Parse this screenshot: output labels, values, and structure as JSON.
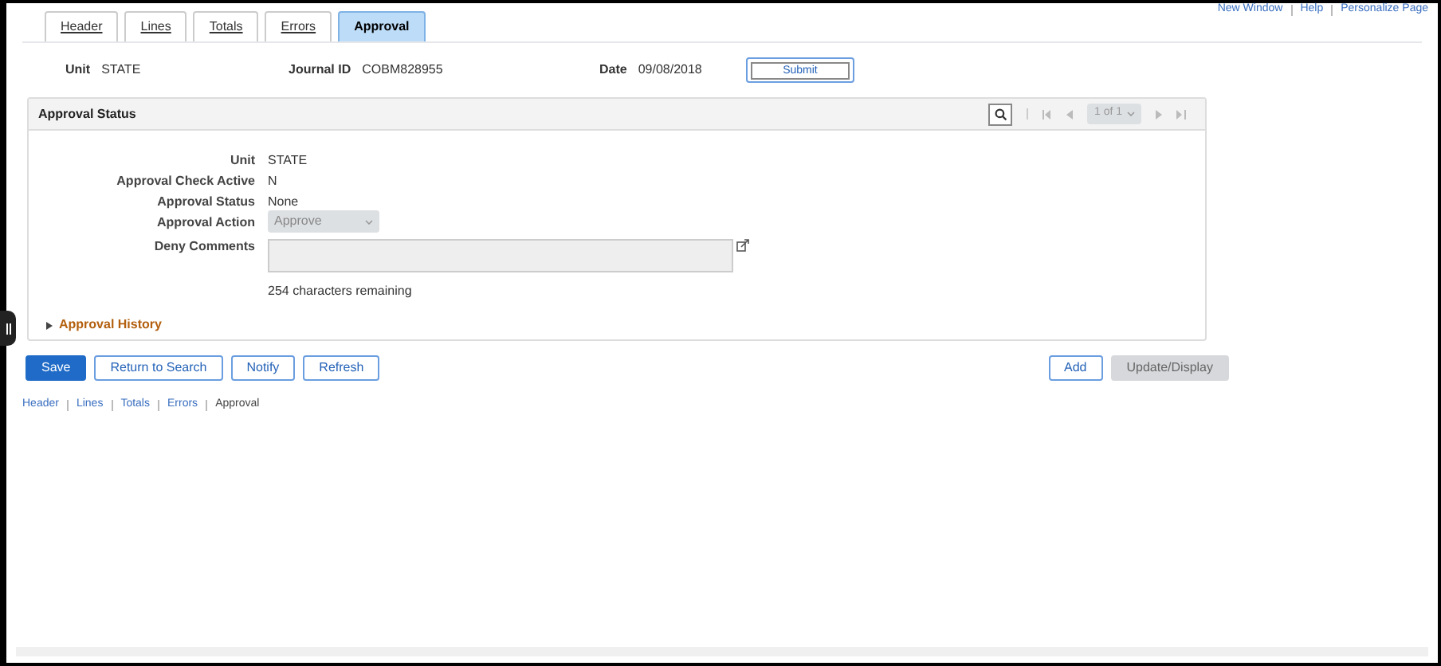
{
  "top_links": [
    "New Window",
    "Help",
    "Personalize Page"
  ],
  "tabs": [
    {
      "label": "Header",
      "selected": false
    },
    {
      "label": "Lines",
      "selected": false
    },
    {
      "label": "Totals",
      "selected": false
    },
    {
      "label": "Errors",
      "selected": false
    },
    {
      "label": "Approval",
      "selected": true
    }
  ],
  "header_fields": [
    {
      "label": "Unit",
      "value": "STATE"
    },
    {
      "label": "Journal ID",
      "value": "COBM828955"
    },
    {
      "label": "Date",
      "value": "09/08/2018"
    }
  ],
  "submit_button": "Submit",
  "panel": {
    "title": "Approval Status",
    "pager": {
      "value": "1 of 1",
      "disabled": true
    },
    "fields": [
      {
        "kind": "text",
        "label": "Unit",
        "value": "STATE"
      },
      {
        "kind": "text",
        "label": "Approval Check Active",
        "value": "N"
      },
      {
        "kind": "text",
        "label": "Approval Status",
        "value": "None"
      },
      {
        "kind": "select",
        "label": "Approval Action",
        "value": "Approve",
        "disabled": true
      },
      {
        "kind": "textarea",
        "label": "Deny Comments",
        "disabled": true
      }
    ],
    "remaining": "254 characters remaining",
    "history": {
      "label": "Approval History",
      "expanded": false
    }
  },
  "buttons_left": [
    {
      "label": "Save",
      "kind": "primary"
    },
    {
      "label": "Return to Search",
      "kind": "default"
    },
    {
      "label": "Notify",
      "kind": "default"
    },
    {
      "label": "Refresh",
      "kind": "default"
    }
  ],
  "buttons_right": [
    {
      "label": "Add",
      "kind": "default"
    },
    {
      "label": "Update/Display",
      "kind": "disabled"
    }
  ],
  "bottom_links": [
    {
      "label": "Header",
      "selected": false
    },
    {
      "label": "Lines",
      "selected": false
    },
    {
      "label": "Totals",
      "selected": false
    },
    {
      "label": "Errors",
      "selected": false
    },
    {
      "label": "Approval",
      "selected": true
    }
  ]
}
